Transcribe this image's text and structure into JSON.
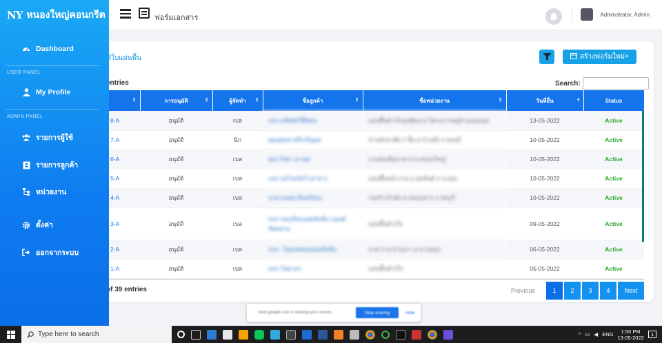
{
  "sidebar": {
    "brand_logo": "NY",
    "brand_name": "หนองใหญ่คอนกรีต",
    "dashboard": "Dashboard",
    "user_panel": "USER PANEL",
    "my_profile": "My Profile",
    "admin_panel": "ADMIN PANEL",
    "users": "รายการผู้ใช้",
    "customers": "รายการลูกค้า",
    "units": "หน่วยงาน",
    "settings": "ตั้งค่า",
    "logout": "ออกจากระบบ"
  },
  "topbar": {
    "page_label": "ฟอร์มเอกสาร",
    "username": "Adminstrator, Admin"
  },
  "card": {
    "crumb": "ฟ้ใบแผ่นพื้น",
    "new_button": "สร้างฟอร์มใหม่+",
    "entries_top": "entries",
    "search_label": "Search:",
    "entries_bottom": "of 39 entries"
  },
  "table": {
    "headers": [
      "",
      "การอนุมัติ",
      "ผู้จัดทำ",
      "ชื่อลูกค้า",
      "ชื่อหน่วยงาน",
      "วันที่ยื่น",
      "Status"
    ],
    "rows": [
      {
        "code": "8-A",
        "approval": "อนุมัติ",
        "maker": "เบล",
        "customer": "บจก.ทรัพย์ทวีพืชผล",
        "unit": "แผ่นพื้นสำเร็จรูปอัดแรง โครงการหมู่บ้านแสนสุข",
        "date": "13-05-2022",
        "status": "Active"
      },
      {
        "code": "7-A",
        "approval": "อนุมัติ",
        "maker": "นิก",
        "customer": "คุณสุนทร ศรีเจริญผล",
        "unit": "บ้านพักอาศัย 2 ชั้น ต.บ้านบึง จ.ชลบุรี",
        "date": "10-05-2022",
        "status": "Active"
      },
      {
        "code": "6-A",
        "approval": "อนุมัติ",
        "maker": "เบล",
        "customer": "คุณ วิทยา มานพ",
        "unit": "งานต่อเติมอาคาร ต.หนองใหญ่",
        "date": "10-05-2022",
        "status": "Active"
      },
      {
        "code": "5-A",
        "approval": "อนุมัติ",
        "maker": "เบล",
        "customer": "บจก.รุ่งโรจน์ทวี (สาขา)",
        "unit": "แผ่นพื้นหน้างาน ม.สุขสันต์ จ.ระยอง",
        "date": "10-05-2022",
        "status": "Active"
      },
      {
        "code": "4-A",
        "approval": "อนุมัติ",
        "maker": "เบล",
        "customer": "นาย ธนพล อินทร์ทอง",
        "unit": "ก่อสร้างโกดัง ต.หนองชาก จ.ชลบุรี",
        "date": "10-05-2022",
        "status": "Active"
      },
      {
        "code": "3-A",
        "approval": "อนุมัติ",
        "maker": "เบล",
        "customer": "หจก.ชลบุรีคอนสตรัคชั่น แอนด์ ซัพพลาย",
        "unit": "แผ่นพื้นสำเร็จ",
        "date": "09-05-2022",
        "status": "Active"
      },
      {
        "code": "2-A",
        "approval": "อนุมัติ",
        "maker": "เบล",
        "customer": "บจก. โฮมเทคคอนสตรัคชั่น",
        "unit": "อาคาร ต.บ้านเก่า อ.พานทอง",
        "date": "06-05-2022",
        "status": "Active"
      },
      {
        "code": "1-A",
        "approval": "อนุมัติ",
        "maker": "เบล",
        "customer": "หจก.วิทยาธร",
        "unit": "แผ่นพื้นสำเร็จ",
        "date": "05-05-2022",
        "status": "Active"
      }
    ]
  },
  "pager": {
    "previous": "Previous",
    "pages": [
      "1",
      "2",
      "3",
      "4"
    ],
    "next": "Next"
  },
  "share_bar": {
    "message": "meet.google.com is sharing your screen.",
    "stop": "Stop sharing",
    "hide": "Hide"
  },
  "taskbar": {
    "search_placeholder": "Type here to search",
    "lang": "ENG",
    "time": "1:50 PM",
    "date": "13-05-2022",
    "notifications": "1"
  },
  "colors": {
    "sidebar_top": "#1aa9f5",
    "sidebar_bottom": "#0b6fe8",
    "header_blue": "#1474eb",
    "status_green": "#2aa72a"
  }
}
